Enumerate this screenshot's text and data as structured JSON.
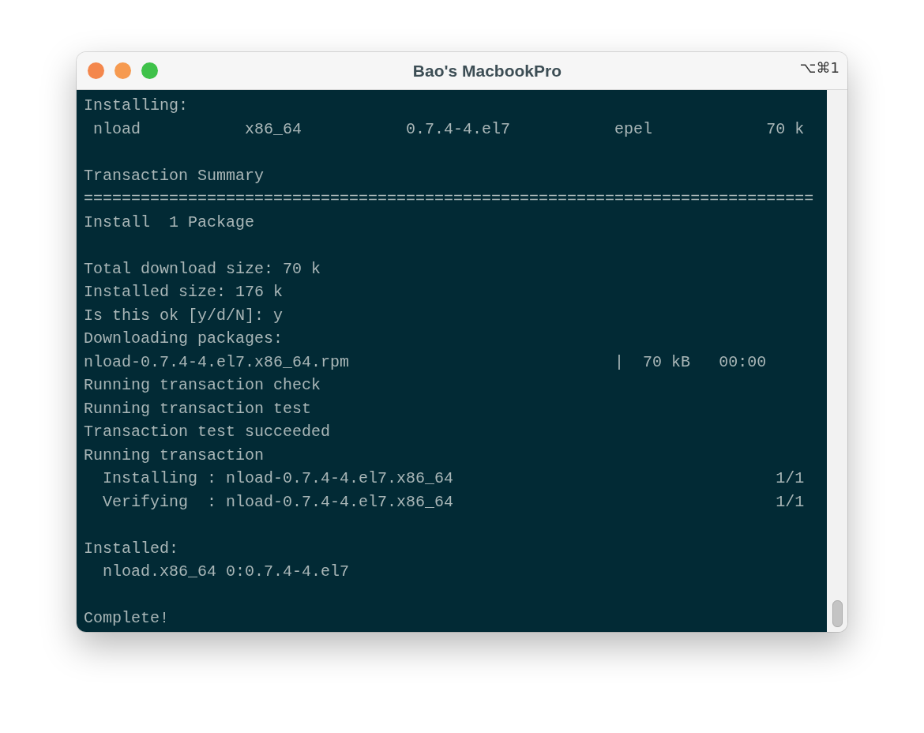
{
  "window": {
    "title": "Bao's MacbookPro",
    "shortcut": "⌥⌘1"
  },
  "terminal": {
    "blocks": [
      [
        "Installing:",
        " nload           x86_64           0.7.4-4.el7           epel            70 k"
      ],
      [
        "Transaction Summary",
        "=============================================================================",
        "Install  1 Package"
      ],
      [
        "Total download size: 70 k",
        "Installed size: 176 k",
        "Is this ok [y/d/N]: y",
        "Downloading packages:",
        "nload-0.7.4-4.el7.x86_64.rpm                            |  70 kB   00:00",
        "Running transaction check",
        "Running transaction test",
        "Transaction test succeeded",
        "Running transaction",
        "  Installing : nload-0.7.4-4.el7.x86_64                                  1/1",
        "  Verifying  : nload-0.7.4-4.el7.x86_64                                  1/1"
      ],
      [
        "Installed:",
        "  nload.x86_64 0:0.7.4-4.el7"
      ],
      [
        "Complete!"
      ]
    ]
  }
}
